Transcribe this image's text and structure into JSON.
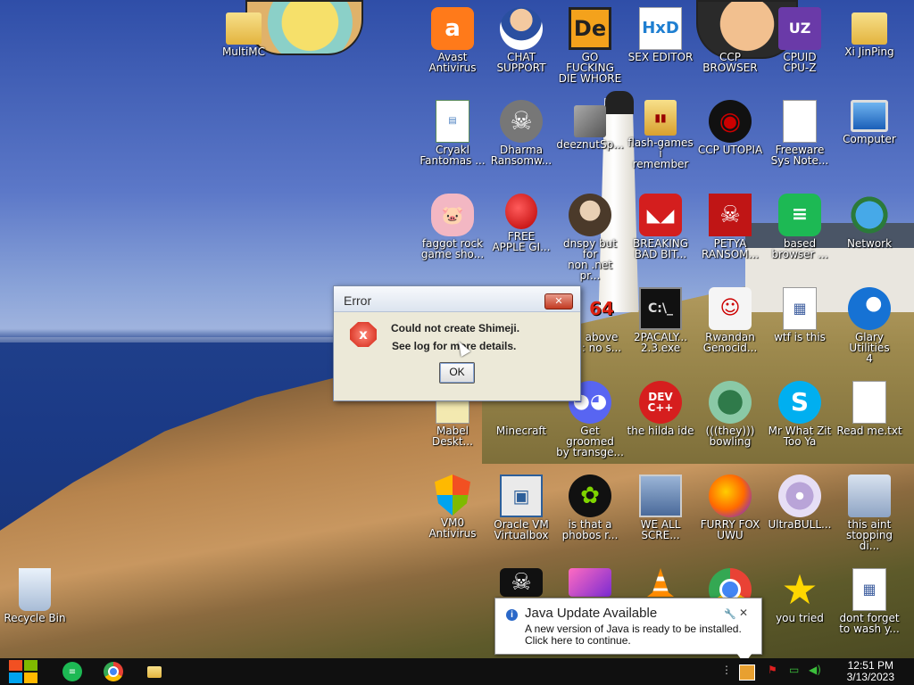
{
  "desktop": {
    "icons": [
      {
        "label": "MultiMC",
        "icon": "folder-icon"
      },
      {
        "label": "Avast\nAntivirus",
        "icon": "avast-icon"
      },
      {
        "label": "CHAT\nSUPPORT",
        "icon": "doctor-icon"
      },
      {
        "label": "GO FUCKING\nDIE WHORE",
        "icon": "de-icon"
      },
      {
        "label": "SEX EDITOR",
        "icon": "hxd-icon"
      },
      {
        "label": "CCP\nBROWSER",
        "icon": "chrome-icon"
      },
      {
        "label": "CPUID\nCPU-Z",
        "icon": "cpuz-icon"
      },
      {
        "label": "Xi JinPing",
        "icon": "user-folder-icon"
      },
      {
        "label": "Cryakl\nFantomas ...",
        "icon": "document-window-icon"
      },
      {
        "label": "Dharma\nRansomw...",
        "icon": "skull-ring-icon"
      },
      {
        "label": "deeznutSp...",
        "icon": "stack-icon"
      },
      {
        "label": "flash-games i\nremember",
        "icon": "folder-icon"
      },
      {
        "label": "CCP UTOPIA",
        "icon": "dark-globe-icon"
      },
      {
        "label": "Freeware\nSys Note...",
        "icon": "document-icon"
      },
      {
        "label": "Computer",
        "icon": "computer-icon"
      },
      {
        "label": "faggot rock\ngame sho...",
        "icon": "pig-icon"
      },
      {
        "label": "FREE\nAPPLE GI...",
        "icon": "apple-icon"
      },
      {
        "label": "dnspy but for\nnon .net pr...",
        "icon": "lady-icon"
      },
      {
        "label": "BREAKING\nBAD BIT...",
        "icon": "angry-bird-icon"
      },
      {
        "label": "PETYA\nRANSOM...",
        "icon": "skull-crossbones-icon"
      },
      {
        "label": "based\nbrowser ...",
        "icon": "green-chat-icon"
      },
      {
        "label": "Network",
        "icon": "network-icon"
      },
      {
        "label": "above\n: no s...",
        "icon": "number-icon"
      },
      {
        "label": "2PACALY...\n2.3.exe",
        "icon": "cmd-icon"
      },
      {
        "label": "Rwandan\nGenocid...",
        "icon": "meme-face-icon"
      },
      {
        "label": "wtf is this",
        "icon": "calendar-icon"
      },
      {
        "label": "Glary Utilities\n4",
        "icon": "glary-icon"
      },
      {
        "label": "Mabel\nDeskt...",
        "icon": "document-icon"
      },
      {
        "label": "Minecraft",
        "icon": "minecraft-icon"
      },
      {
        "label": "Get groomed\nby transge...",
        "icon": "discord-icon"
      },
      {
        "label": "the hilda ide",
        "icon": "devcpp-icon"
      },
      {
        "label": "(((they)))\nbowling",
        "icon": "bowling-icon"
      },
      {
        "label": "Mr What Zit\nToo Ya",
        "icon": "skype-icon"
      },
      {
        "label": "Read me.txt",
        "icon": "text-file-icon"
      },
      {
        "label": "VM0\nAntivirus",
        "icon": "shield-icon"
      },
      {
        "label": "Oracle VM\nVirtualbox",
        "icon": "virtualbox-icon"
      },
      {
        "label": "is that a\nphobos r...",
        "icon": "icq-icon"
      },
      {
        "label": "WE ALL\nSCRE...",
        "icon": "monitor-icon"
      },
      {
        "label": "FURRY FOX\nUWU",
        "icon": "firefox-icon"
      },
      {
        "label": "UltraBULL...",
        "icon": "disc-icon"
      },
      {
        "label": "this aint\nstopping di...",
        "icon": "pc-printer-icon"
      },
      {
        "label": "Recycle Bin",
        "icon": "recycle-bin-icon"
      },
      {
        "label": "",
        "icon": "black-skull-icon"
      },
      {
        "label": "",
        "icon": "pink-media-icon"
      },
      {
        "label": "",
        "icon": "vlc-cone-icon"
      },
      {
        "label": "",
        "icon": "chrome-icon"
      },
      {
        "label": "you tried",
        "icon": "star-icon"
      },
      {
        "label": "dont forget\nto wash y...",
        "icon": "calendar-icon"
      }
    ]
  },
  "error_dialog": {
    "title": "Error",
    "close_label": "✕",
    "icon_glyph": "x",
    "message_line1": "Could not create Shimeji.",
    "message_line2": "See log for more details.",
    "ok_label": "OK"
  },
  "java_notification": {
    "title": "Java Update Available",
    "body_line1": "A new version of Java is ready to be installed.",
    "body_line2": "Click here to continue.",
    "info_glyph": "i",
    "close_glyph": "✕",
    "settings_glyph": "🔧"
  },
  "taskbar": {
    "start_colors": [
      "#f25022",
      "#7fba00",
      "#00a4ef",
      "#ffb900"
    ],
    "clock_time": "12:51 PM",
    "clock_date": "3/13/2023",
    "tray_more_glyph": "⋮"
  }
}
